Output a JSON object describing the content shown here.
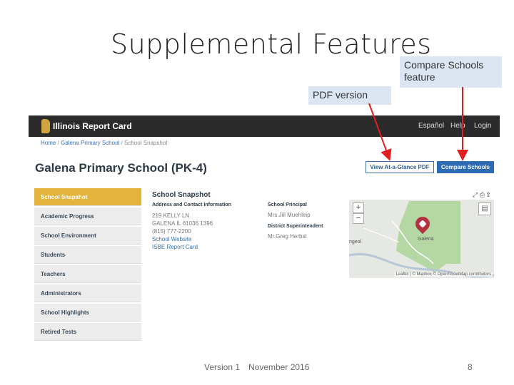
{
  "slide": {
    "title": "Supplemental Features",
    "callout_compare": "Compare Schools feature",
    "callout_pdf": "PDF version",
    "footer_version": "Version 1",
    "footer_date": "November 2016",
    "page_number": "8"
  },
  "app": {
    "brand": "Illinois Report Card",
    "nav": {
      "espanol": "Español",
      "help": "Help",
      "login": "Login"
    },
    "breadcrumb": [
      "Home",
      "Galena Primary School",
      "School Snapshot"
    ],
    "school_name": "Galena Primary School (PK-4)",
    "buttons": {
      "pdf": "View At-a-Glance PDF",
      "compare": "Compare Schools"
    },
    "sidebar": [
      {
        "label": "School Snapshot"
      },
      {
        "label": "Academic Progress"
      },
      {
        "label": "School Environment"
      },
      {
        "label": "Students"
      },
      {
        "label": "Teachers"
      },
      {
        "label": "Administrators"
      },
      {
        "label": "School Highlights"
      },
      {
        "label": "Retired Tests"
      }
    ],
    "snapshot": {
      "title": "School Snapshot",
      "address_heading": "Address and Contact Information",
      "address_line1": "219 KELLY LN",
      "address_line2": "GALENA IL 61036 1396",
      "phone": "(815) 777-2200",
      "website_link": "School Website",
      "isbe_link": "ISBE Report Card",
      "principal_heading": "School Principal",
      "principal": "Mrs.Jill Muehleip",
      "superintendent_heading": "District Superintendent",
      "superintendent": "Mr.Greg Herbst"
    },
    "map": {
      "zoom_in": "+",
      "zoom_out": "−",
      "city_label": "Galena",
      "west_label": "ngeol",
      "attribution": "Leaflet | © Mapbox © OpenStreetMap contributors"
    }
  },
  "colors": {
    "accent_gold": "#e3b43c",
    "primary_blue": "#2e6bb5",
    "arrow_red": "#e02020",
    "callout_bg": "#dce6f2"
  }
}
